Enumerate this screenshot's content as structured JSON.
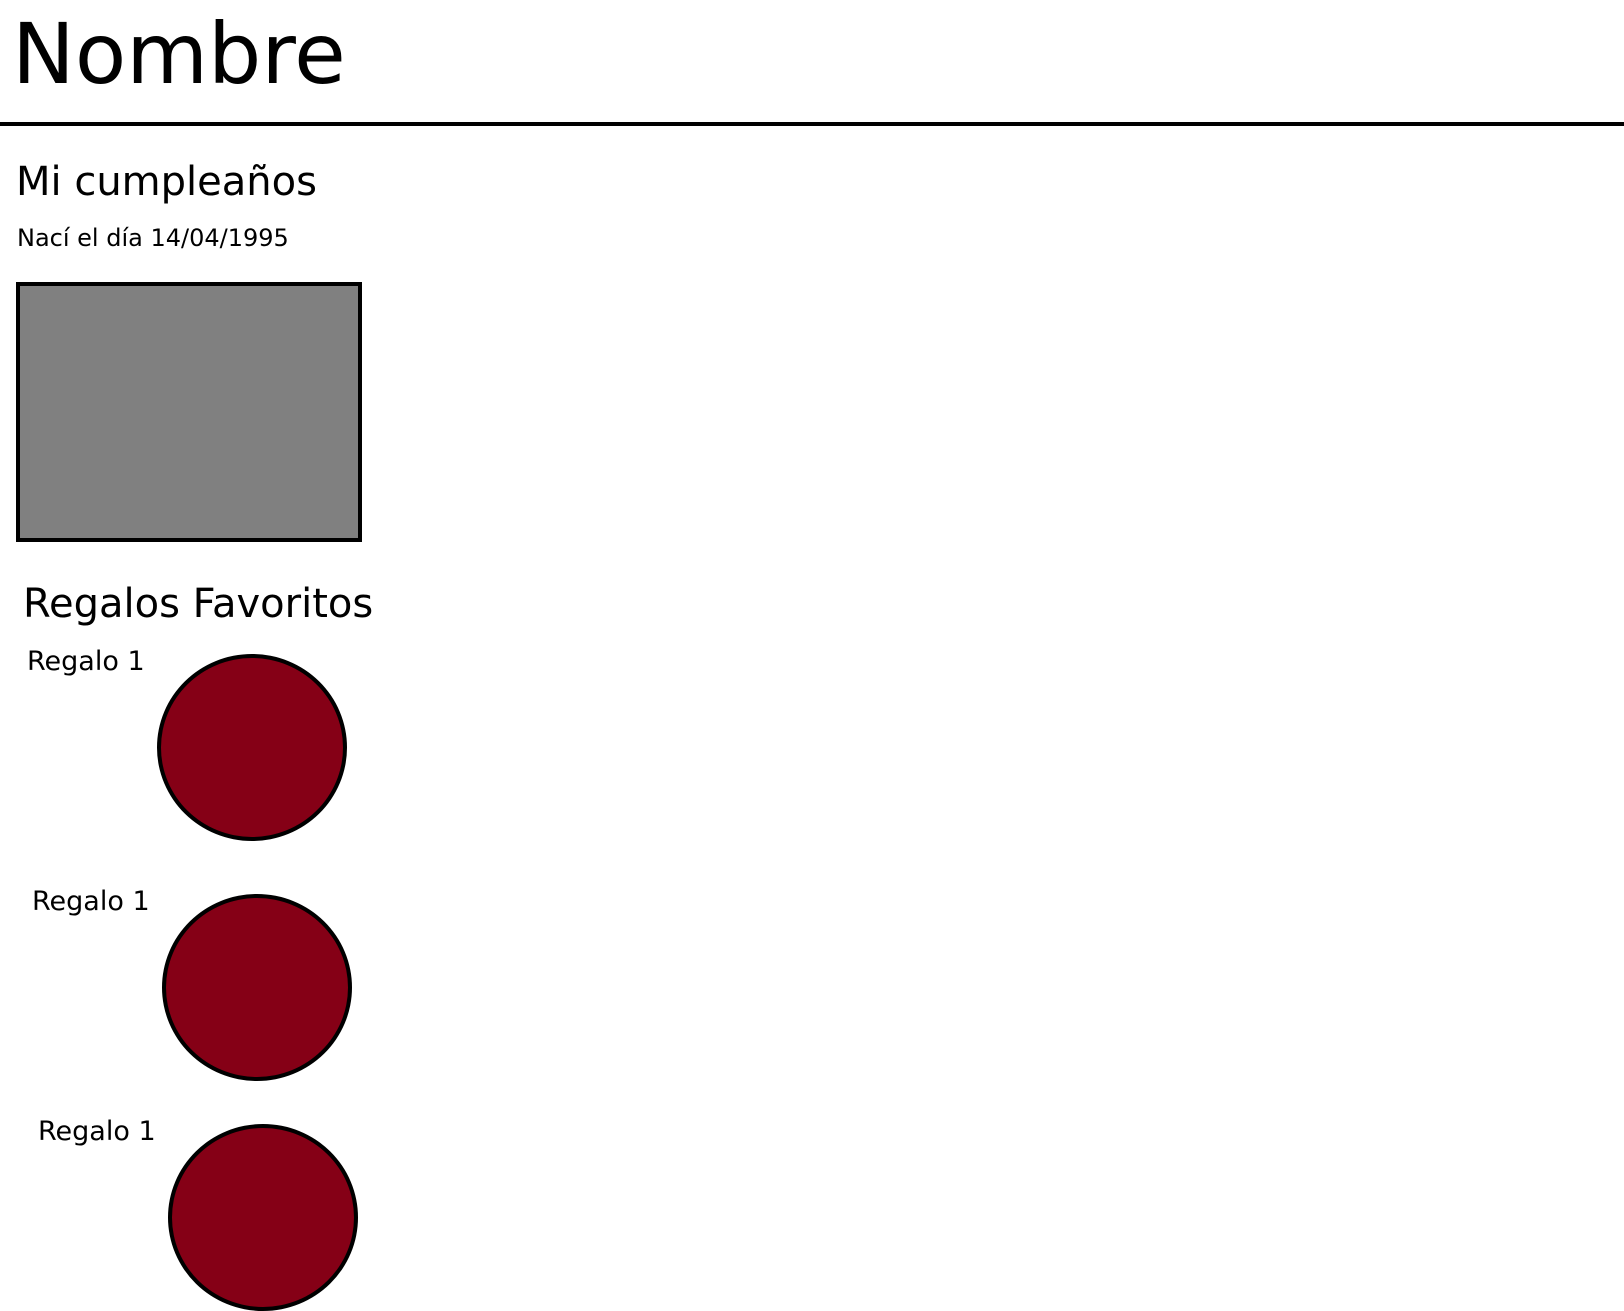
{
  "header": {
    "title": "Nombre"
  },
  "birthday": {
    "heading": "Mi cumpleaños",
    "text": "Nací el día 14/04/1995"
  },
  "gifts": {
    "heading": "Regalos Favoritos",
    "items": [
      {
        "label": "Regalo 1"
      },
      {
        "label": "Regalo 1"
      },
      {
        "label": "Regalo 1"
      }
    ]
  },
  "colors": {
    "photo_placeholder": "#808080",
    "gift_circle": "#850016"
  }
}
